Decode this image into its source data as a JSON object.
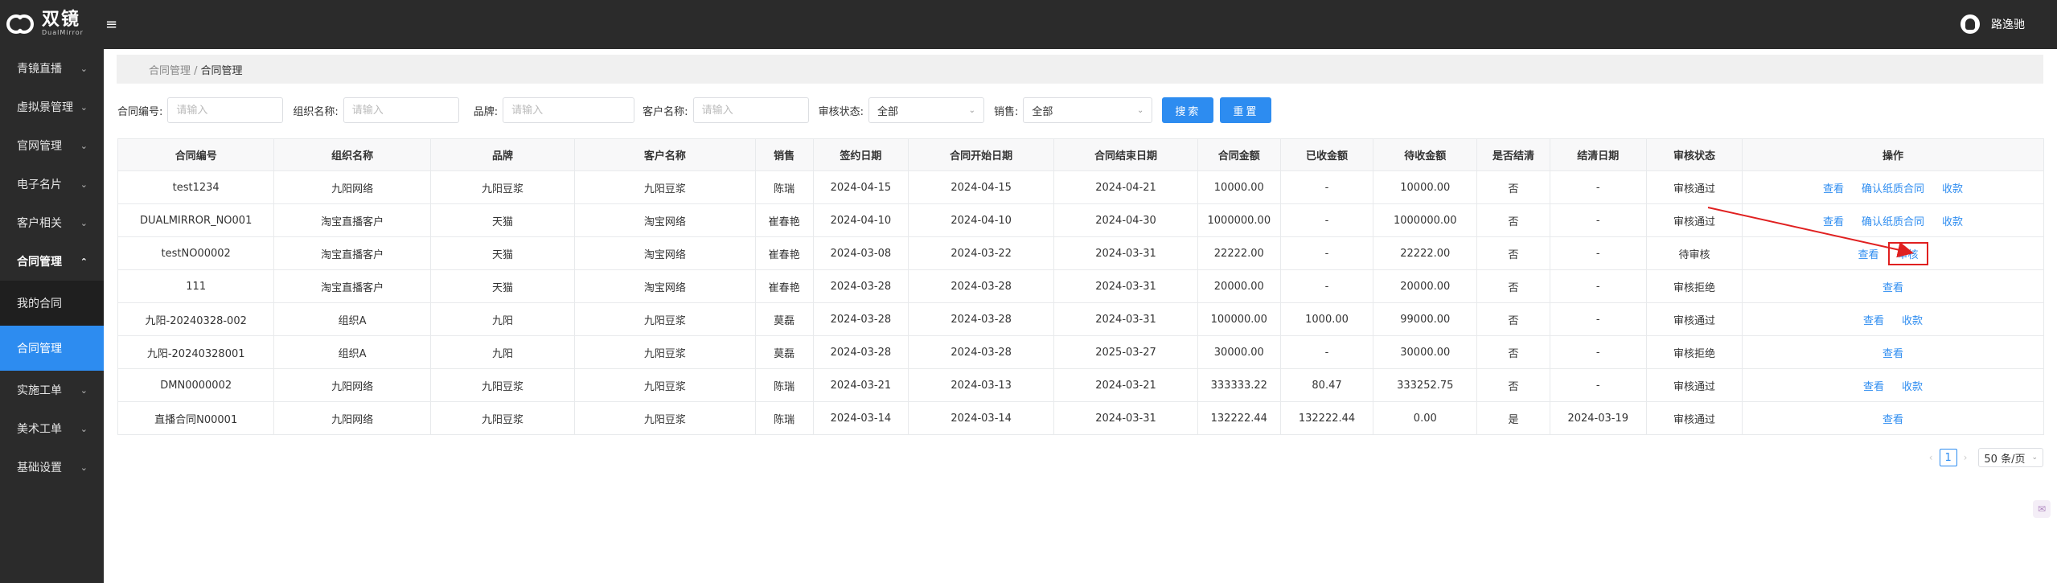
{
  "header": {
    "logo_cn": "双镜",
    "logo_en": "DualMirror",
    "menu_toggle_icon": "≡",
    "user_name": "路逸驰"
  },
  "sidebar": {
    "items": [
      {
        "label": "青镜直播"
      },
      {
        "label": "虚拟景管理"
      },
      {
        "label": "官网管理"
      },
      {
        "label": "电子名片"
      },
      {
        "label": "客户相关"
      },
      {
        "label": "合同管理"
      },
      {
        "label": "实施工单"
      },
      {
        "label": "美术工单"
      },
      {
        "label": "基础设置"
      }
    ],
    "sub_items": [
      {
        "label": "我的合同"
      },
      {
        "label": "合同管理"
      }
    ]
  },
  "breadcrumb": {
    "parent": "合同管理 /",
    "current": "合同管理"
  },
  "filters": {
    "contract_no_label": "合同编号:",
    "org_name_label": "组织名称:",
    "brand_label": "品牌:",
    "customer_label": "客户名称:",
    "review_status_label": "审核状态:",
    "sales_label": "销售:",
    "placeholder": "请输入",
    "review_status_value": "全部",
    "sales_value": "全部",
    "search_button": "搜索",
    "reset_button": "重置"
  },
  "table": {
    "headers": [
      "合同编号",
      "组织名称",
      "品牌",
      "客户名称",
      "销售",
      "签约日期",
      "合同开始日期",
      "合同结束日期",
      "合同金额",
      "已收金额",
      "待收金额",
      "是否结清",
      "结清日期",
      "审核状态",
      "操作"
    ],
    "rows": [
      {
        "no": "test1234",
        "org": "九阳网络",
        "brand": "九阳豆浆",
        "customer": "九阳豆浆",
        "sales": "陈瑞",
        "sign": "2024-04-15",
        "start": "2024-04-15",
        "end": "2024-04-21",
        "amount": "10000.00",
        "received": "-",
        "pending": "10000.00",
        "settled": "否",
        "settle_date": "-",
        "status": "审核通过",
        "ops": [
          "查看",
          "确认纸质合同",
          "收款"
        ]
      },
      {
        "no": "DUALMIRROR_NO001",
        "org": "淘宝直播客户",
        "brand": "天猫",
        "customer": "淘宝网络",
        "sales": "崔春艳",
        "sign": "2024-04-10",
        "start": "2024-04-10",
        "end": "2024-04-30",
        "amount": "1000000.00",
        "received": "-",
        "pending": "1000000.00",
        "settled": "否",
        "settle_date": "-",
        "status": "审核通过",
        "ops": [
          "查看",
          "确认纸质合同",
          "收款"
        ]
      },
      {
        "no": "testNO00002",
        "org": "淘宝直播客户",
        "brand": "天猫",
        "customer": "淘宝网络",
        "sales": "崔春艳",
        "sign": "2024-03-08",
        "start": "2024-03-22",
        "end": "2024-03-31",
        "amount": "22222.00",
        "received": "-",
        "pending": "22222.00",
        "settled": "否",
        "settle_date": "-",
        "status": "待审核",
        "ops": [
          "查看",
          "审核"
        ]
      },
      {
        "no": "111",
        "org": "淘宝直播客户",
        "brand": "天猫",
        "customer": "淘宝网络",
        "sales": "崔春艳",
        "sign": "2024-03-28",
        "start": "2024-03-28",
        "end": "2024-03-31",
        "amount": "20000.00",
        "received": "-",
        "pending": "20000.00",
        "settled": "否",
        "settle_date": "-",
        "status": "审核拒绝",
        "ops": [
          "查看"
        ]
      },
      {
        "no": "九阳-20240328-002",
        "org": "组织A",
        "brand": "九阳",
        "customer": "九阳豆浆",
        "sales": "莫磊",
        "sign": "2024-03-28",
        "start": "2024-03-28",
        "end": "2024-03-31",
        "amount": "100000.00",
        "received": "1000.00",
        "pending": "99000.00",
        "settled": "否",
        "settle_date": "-",
        "status": "审核通过",
        "ops": [
          "查看",
          "收款"
        ]
      },
      {
        "no": "九阳-20240328001",
        "org": "组织A",
        "brand": "九阳",
        "customer": "九阳豆浆",
        "sales": "莫磊",
        "sign": "2024-03-28",
        "start": "2024-03-28",
        "end": "2025-03-27",
        "amount": "30000.00",
        "received": "-",
        "pending": "30000.00",
        "settled": "否",
        "settle_date": "-",
        "status": "审核拒绝",
        "ops": [
          "查看"
        ]
      },
      {
        "no": "DMN0000002",
        "org": "九阳网络",
        "brand": "九阳豆浆",
        "customer": "九阳豆浆",
        "sales": "陈瑞",
        "sign": "2024-03-21",
        "start": "2024-03-13",
        "end": "2024-03-21",
        "amount": "333333.22",
        "received": "80.47",
        "pending": "333252.75",
        "settled": "否",
        "settle_date": "-",
        "status": "审核通过",
        "ops": [
          "查看",
          "收款"
        ]
      },
      {
        "no": "直播合同N00001",
        "org": "九阳网络",
        "brand": "九阳豆浆",
        "customer": "九阳豆浆",
        "sales": "陈瑞",
        "sign": "2024-03-14",
        "start": "2024-03-14",
        "end": "2024-03-31",
        "amount": "132222.44",
        "received": "132222.44",
        "pending": "0.00",
        "settled": "是",
        "settle_date": "2024-03-19",
        "status": "审核通过",
        "ops": [
          "查看"
        ]
      }
    ]
  },
  "pagination": {
    "prev": "‹",
    "current_page": "1",
    "next": "›",
    "page_size": "50 条/页"
  },
  "colors": {
    "topbar": "#2b2b2b",
    "accent": "#2d8cf0",
    "annotation": "#e02020"
  }
}
